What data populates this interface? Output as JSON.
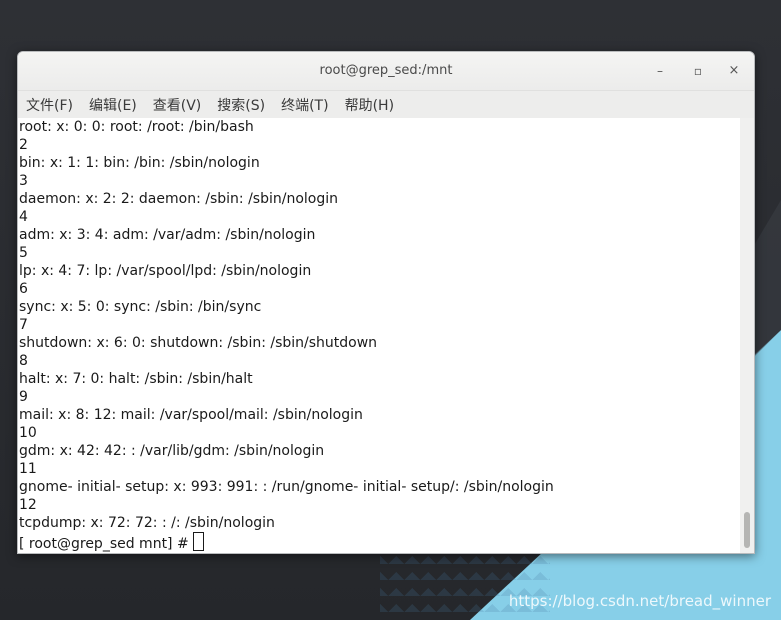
{
  "window": {
    "title": "root@grep_sed:/mnt",
    "controls": {
      "minimize": "–",
      "maximize": "▫",
      "close": "×"
    }
  },
  "menu": [
    "文件(F)",
    "编辑(E)",
    "查看(V)",
    "搜索(S)",
    "终端(T)",
    "帮助(H)"
  ],
  "terminal": {
    "lines": [
      "root: x: 0: 0: root: /root: /bin/bash",
      "2",
      "bin: x: 1: 1: bin: /bin: /sbin/nologin",
      "3",
      "daemon: x: 2: 2: daemon: /sbin: /sbin/nologin",
      "4",
      "adm: x: 3: 4: adm: /var/adm: /sbin/nologin",
      "5",
      "lp: x: 4: 7: lp: /var/spool/lpd: /sbin/nologin",
      "6",
      "sync: x: 5: 0: sync: /sbin: /bin/sync",
      "7",
      "shutdown: x: 6: 0: shutdown: /sbin: /sbin/shutdown",
      "8",
      "halt: x: 7: 0: halt: /sbin: /sbin/halt",
      "9",
      "mail: x: 8: 12: mail: /var/spool/mail: /sbin/nologin",
      "10",
      "gdm: x: 42: 42: : /var/lib/gdm: /sbin/nologin",
      "11",
      "gnome- initial- setup: x: 993: 991: : /run/gnome- initial- setup/: /sbin/nologin",
      "12",
      "tcpdump: x: 72: 72: : /: /sbin/nologin"
    ],
    "prompt": "[ root@grep_sed mnt] #"
  },
  "watermark": "https://blog.csdn.net/bread_winner"
}
